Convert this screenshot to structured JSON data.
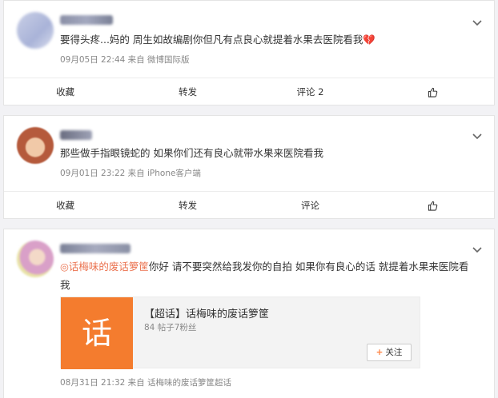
{
  "posts": [
    {
      "text": "要得头疼...妈的 周生如故编剧你但凡有点良心就提着水果去医院看我💔",
      "meta": "09月05日 22:44  来自 微博国际版",
      "actions": {
        "collect": "收藏",
        "repost": "转发",
        "comment": "评论 2"
      }
    },
    {
      "text": "那些做手指眼镜蛇的 如果你们还有良心就带水果来医院看我",
      "meta": "09月01日 23:22  来自 iPhone客户端",
      "actions": {
        "collect": "收藏",
        "repost": "转发",
        "comment": "评论"
      }
    },
    {
      "topic_link": "◎话梅味的废话箩筐",
      "text": "你好 请不要突然给我发你的自拍 如果你有良心的话 就提着水果来医院看我",
      "topic_card": {
        "tile_char": "话",
        "title": "【超话】话梅味的废话箩筐",
        "sub": "84 帖子7粉丝",
        "follow_label": "关注"
      },
      "meta": "08月31日 21:32  来自 话梅味的废话箩筐超话",
      "actions": {}
    }
  ],
  "colors": {
    "accent": "#eb7350",
    "tile": "#f47c2e"
  }
}
